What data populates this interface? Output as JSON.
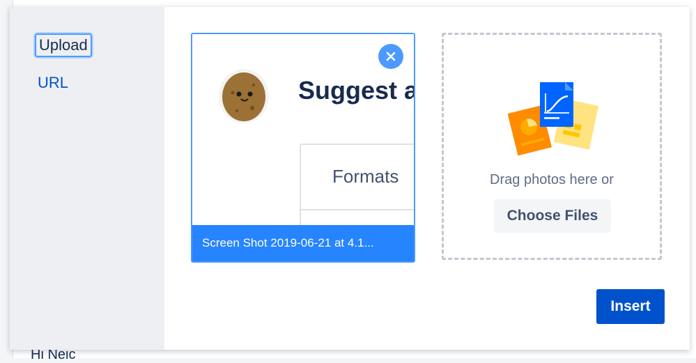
{
  "background": {
    "text": "Hi Neic"
  },
  "dialog": {
    "tabs": [
      {
        "label": "Upload",
        "active": true
      },
      {
        "label": "URL",
        "active": false
      }
    ],
    "file_card": {
      "filename": "Screen Shot 2019-06-21 at 4.1...",
      "preview": {
        "title": "Suggest a",
        "box_label": "Formats"
      },
      "close_icon": "close-icon"
    },
    "dropzone": {
      "text": "Drag photos here or",
      "choose_label": "Choose Files",
      "illustration_icon": "documents-icon"
    },
    "insert_label": "Insert"
  },
  "colors": {
    "accent": "#0052cc",
    "selection": "#4c9aff",
    "caption_bg": "#2684ff",
    "sidebar_bg": "#eeeff2"
  }
}
